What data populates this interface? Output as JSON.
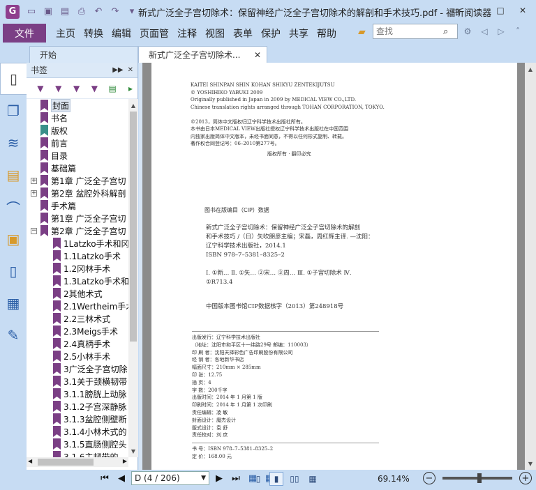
{
  "app": {
    "logo_letter": "G",
    "window_title": "新式广泛全子宫切除术：保留神经广泛全子宫切除术的解剖和手术技巧.pdf - 福昕阅读器"
  },
  "menu": {
    "file": "文件",
    "items": [
      "主页",
      "转换",
      "编辑",
      "页面管",
      "注释",
      "视图",
      "表单",
      "保护",
      "共享",
      "帮助"
    ]
  },
  "search": {
    "placeholder": "查找"
  },
  "tabs": [
    {
      "label": "开始"
    },
    {
      "label": "新式广泛全子宫切除术..."
    }
  ],
  "panel": {
    "title": "书签"
  },
  "bookmarks": [
    {
      "label": "封面",
      "level": 0,
      "expander": "",
      "selected": true,
      "color": "purple"
    },
    {
      "label": "书名",
      "level": 0,
      "expander": "",
      "color": "purple"
    },
    {
      "label": "版权",
      "level": 0,
      "expander": "",
      "color": "teal"
    },
    {
      "label": "前言",
      "level": 0,
      "expander": "",
      "color": "purple"
    },
    {
      "label": "目录",
      "level": 0,
      "expander": "",
      "color": "purple"
    },
    {
      "label": "基础篇",
      "level": 0,
      "expander": "",
      "color": "purple"
    },
    {
      "label": "第1章 广泛全子宫切",
      "level": 0,
      "expander": "+",
      "color": "purple"
    },
    {
      "label": "第2章 盆腔外科解剖",
      "level": 0,
      "expander": "+",
      "color": "purple"
    },
    {
      "label": "手术篇",
      "level": 0,
      "expander": "",
      "color": "purple"
    },
    {
      "label": "第1章 广泛全子宫切",
      "level": 0,
      "expander": "",
      "color": "purple"
    },
    {
      "label": "第2章 广泛全子宫切",
      "level": 0,
      "expander": "-",
      "color": "purple"
    },
    {
      "label": "1Latzko手术和冈",
      "level": 1,
      "expander": "",
      "color": "purple"
    },
    {
      "label": "1.1Latzko手术",
      "level": 1,
      "expander": "",
      "color": "purple"
    },
    {
      "label": "1.2冈林手术",
      "level": 1,
      "expander": "",
      "color": "purple"
    },
    {
      "label": "1.3Latzko手术和",
      "level": 1,
      "expander": "",
      "color": "purple"
    },
    {
      "label": "2其他术式",
      "level": 1,
      "expander": "",
      "color": "purple"
    },
    {
      "label": "2.1Wertheim手术",
      "level": 1,
      "expander": "",
      "color": "purple"
    },
    {
      "label": "2.2三林术式",
      "level": 1,
      "expander": "",
      "color": "purple"
    },
    {
      "label": "2.3Meigs手术",
      "level": 1,
      "expander": "",
      "color": "purple"
    },
    {
      "label": "2.4真柄手术",
      "level": 1,
      "expander": "",
      "color": "purple"
    },
    {
      "label": "2.5小林手术",
      "level": 1,
      "expander": "",
      "color": "purple"
    },
    {
      "label": "3广泛全子宫切除",
      "level": 1,
      "expander": "",
      "color": "purple"
    },
    {
      "label": "3.1关于颈横韧带",
      "level": 1,
      "expander": "",
      "color": "purple"
    },
    {
      "label": "3.1.1膀胱上动脉",
      "level": 1,
      "expander": "",
      "color": "purple"
    },
    {
      "label": "3.1.2子宫深静脉",
      "level": 1,
      "expander": "",
      "color": "purple"
    },
    {
      "label": "3.1.3盆腔侧壁断",
      "level": 1,
      "expander": "",
      "color": "purple"
    },
    {
      "label": "3.1.4小林术式的",
      "level": 1,
      "expander": "",
      "color": "purple"
    },
    {
      "label": "3.1.5直肠侧腔头",
      "level": 1,
      "expander": "",
      "color": "purple"
    },
    {
      "label": "3.1.6主韧带的",
      "level": 1,
      "expander": "",
      "color": "purple"
    }
  ],
  "page_text": {
    "copyright": [
      "KAITEI SHINPAN SHIN KOHAN SHIKYU ZENTEKIJUTSU",
      "© YOSHIHIKO YABUKI 2009",
      "Originally published in Japan in 2009 by MEDICAL VIEW CO.,LTD.",
      "Chinese translation rights arranged through TOHAN CORPORATION, TOKYO.",
      "",
      "©2013，简体中文版权归辽宁科学技术出版社所有。",
      "本书由日本MEDICAL VIEW出版社授权辽宁科学技术出版社在中国范围",
      "内独家出版简体中文版本，未经书面同意，不得以任何形式复制、转载。",
      "著作权合同登记号：06–2010第277号。"
    ],
    "rights": "版权所有 · 翻印必究",
    "cip_title": "图书在版编目（CIP）数据",
    "cip": [
      "新式广泛全子宫切除术：保留神经广泛全子宫切除术的解剖",
      "和手术技巧 /（日）矢吹朗彦主编；宋磊，周红辉主译. —沈阳：",
      "辽宁科学技术出版社，2014.1",
      "ISBN 978–7–5381–8325–2",
      "",
      "Ⅰ. ①新…  Ⅱ. ①矢…  ②宋…  ③周…  Ⅲ. ①子宫切除术    Ⅳ.",
      "①R713.4"
    ],
    "cip_no": "中国版本图书馆CIP数据核字（2013）第248918号",
    "pub": [
      "出版发行：辽宁科学技术出版社",
      "（地址：沈阳市和平区十一纬路29号    邮编：110003）",
      "印  刷  者：沈阳天择彩色广告印刷股份有限公司",
      "经  销  者：各地新华书店",
      "幅面尺寸：210mm × 285mm",
      "印       张：12.75",
      "插       页：4",
      "字       数：200千字",
      "出版时间：2014 年 1 月第 1 版",
      "印刷时间：2014 年 1 月第 1 次印刷",
      "责任编辑：凌   敏",
      "封面设计：魔杰设计",
      "版式设计：袁   舒",
      "责任校对：刘   庶"
    ],
    "isbn_label": "书      号：ISBN 978–7–5381–8325–2",
    "price": "定      价：168.00 元"
  },
  "status": {
    "page_field": "D (4 / 206)",
    "zoom": "69.14%"
  }
}
